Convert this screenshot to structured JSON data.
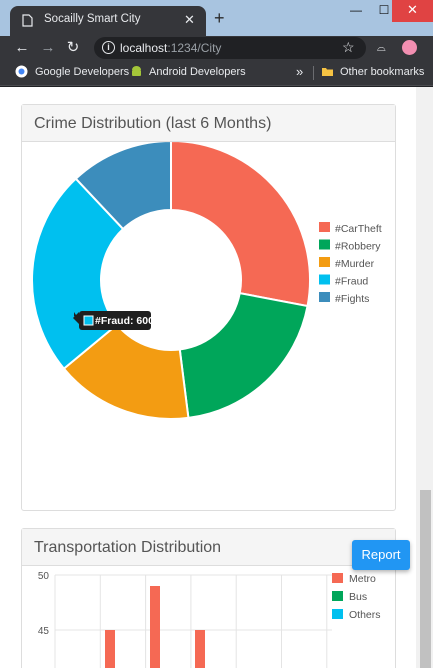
{
  "browser": {
    "tab_title": "Socailly Smart City",
    "tab_close": "✕",
    "new_tab": "+",
    "window_controls": {
      "minimize": "—",
      "maximize": "☐",
      "close": "✕"
    },
    "nav": {
      "back": "←",
      "forward": "→",
      "reload": "↻"
    },
    "url_host": "localhost",
    "url_rest": ":1234/City",
    "bookmarks": [
      "Google Developers",
      "Android Developers"
    ],
    "bookmarks_more": "»",
    "other_bookmarks": "Other bookmarks"
  },
  "colors": {
    "CarTheft": "#f56954",
    "Robbery": "#00a65a",
    "Murder": "#f39c12",
    "Fraud": "#00c0ef",
    "Fights": "#3c8dbc",
    "accent": "#2196f3"
  },
  "report_button": "Report",
  "chart_data": [
    {
      "type": "pie",
      "title": "Crime Distribution (last 6 Months)",
      "donut": true,
      "legend_position": "top-right",
      "categories": [
        "#CarTheft",
        "#Robbery",
        "#Murder",
        "#Fraud",
        "#Fights"
      ],
      "values": [
        700,
        500,
        400,
        600,
        300
      ],
      "colors": [
        "#f56954",
        "#00a65a",
        "#f39c12",
        "#00c0ef",
        "#3c8dbc"
      ],
      "tooltip": {
        "label": "#Fraud: 600",
        "category": "#Fraud"
      }
    },
    {
      "type": "bar",
      "title": "Transportation Distribution",
      "legend_position": "top-right",
      "series": [
        {
          "name": "Metro",
          "color": "#f56954"
        },
        {
          "name": "Bus",
          "color": "#00a65a"
        },
        {
          "name": "Others",
          "color": "#00c0ef"
        }
      ],
      "y_ticks": [
        50,
        45
      ],
      "visible_metro_values": [
        45,
        49,
        45
      ],
      "grid": true
    }
  ]
}
